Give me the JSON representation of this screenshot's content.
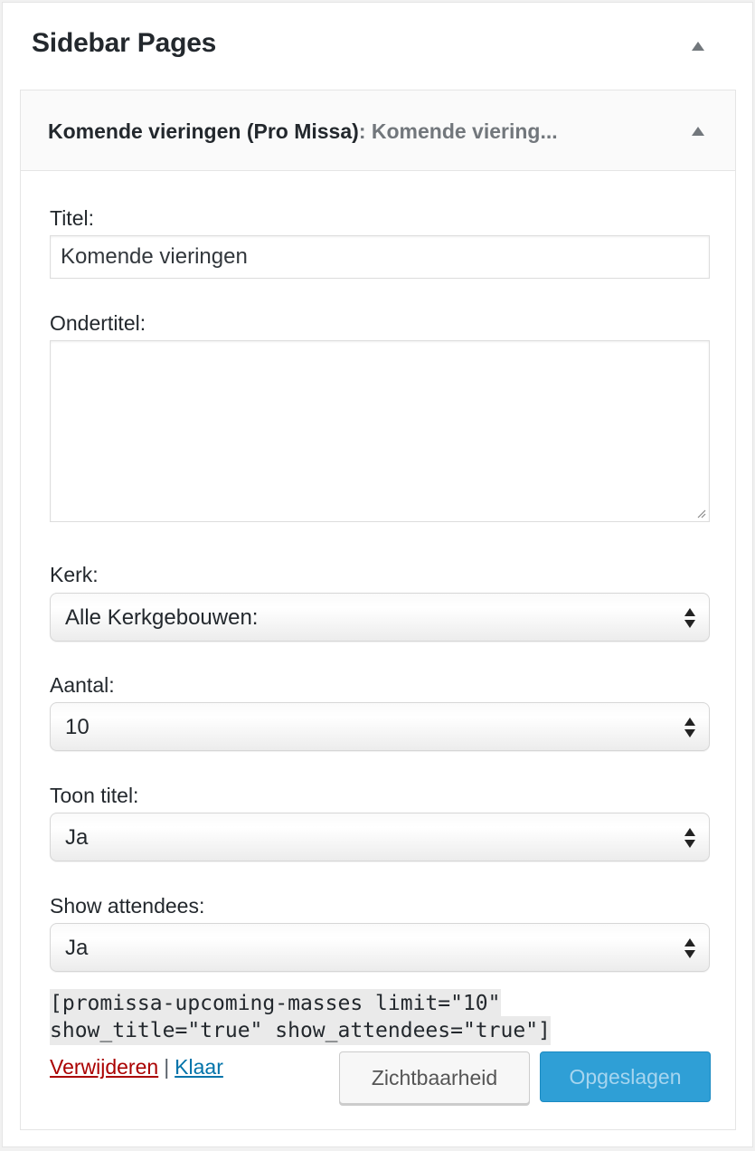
{
  "sidebar": {
    "title": "Sidebar Pages"
  },
  "widget": {
    "name": "Komende vieringen (Pro Missa)",
    "separator": ":",
    "instance_title": "Komende viering..."
  },
  "form": {
    "title_label": "Titel:",
    "title_value": "Komende vieringen",
    "subtitle_label": "Ondertitel:",
    "subtitle_value": "",
    "church_label": "Kerk:",
    "church_selected": "Alle Kerkgebouwen:",
    "count_label": "Aantal:",
    "count_selected": "10",
    "show_title_label": "Toon titel:",
    "show_title_selected": "Ja",
    "show_attendees_label": "Show attendees:",
    "show_attendees_selected": "Ja"
  },
  "shortcode": " [promissa-upcoming-masses limit=\"10\" show_title=\"true\" show_attendees=\"true\"]",
  "actions": {
    "delete_label": "Verwijderen",
    "separator": "|",
    "close_label": "Klaar",
    "visibility_label": "Zichtbaarheid",
    "save_label": "Opgeslagen"
  },
  "colors": {
    "delete_link": "#aa0000",
    "close_link": "#0073aa",
    "save_button": "#2f9fd6"
  },
  "icons": {
    "collapse": "triangle-up-icon",
    "select_arrows": "updown-arrows-icon",
    "resize": "resize-grip-icon"
  }
}
